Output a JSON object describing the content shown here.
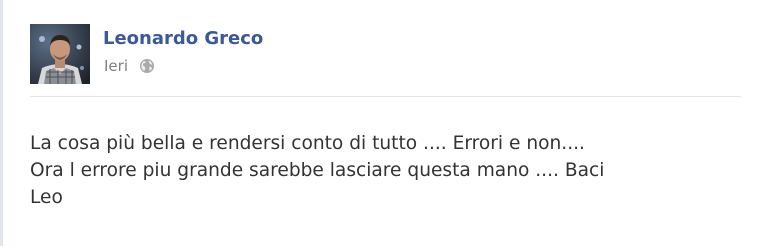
{
  "post": {
    "author_name": "Leonardo Greco",
    "timestamp": "Ieri",
    "privacy_icon": "globe-icon",
    "message_lines": [
      "La cosa più bella e rendersi conto di tutto .... Errori e non....",
      "Ora l errore piu grande sarebbe lasciare questa mano .... Baci",
      "Leo"
    ]
  },
  "colors": {
    "author_link": "#3b5998",
    "meta_text": "#7f7f7f",
    "body_text": "#333333",
    "divider": "#e5e5e5"
  }
}
